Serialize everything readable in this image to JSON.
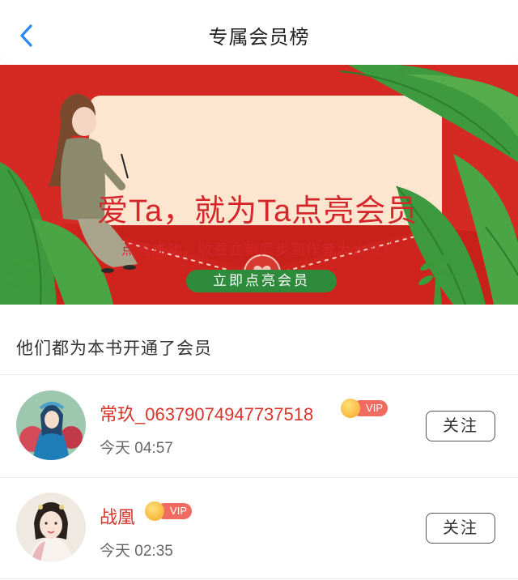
{
  "header": {
    "title": "专属会员榜",
    "back_icon": "chevron-left-icon"
  },
  "banner": {
    "title": "爱Ta，就为Ta点亮会员",
    "subtitle": "点亮成功，收益立刻同步到作者大大账户",
    "cta_label": "立即点亮会员",
    "colors": {
      "background": "#d42a23",
      "card": "#fde6cf",
      "cta": "#2e8b3c",
      "text": "#d5262c"
    }
  },
  "section": {
    "title": "他们都为本书开通了会员"
  },
  "members": [
    {
      "name": "常玖_06379074947737518",
      "badge": "VIP",
      "time": "今天 04:57",
      "follow_label": "关注"
    },
    {
      "name": "战凰",
      "badge": "VIP",
      "time": "今天 02:35",
      "follow_label": "关注"
    }
  ],
  "colors": {
    "accent_blue": "#2a8cf0",
    "name_red": "#d9342b",
    "vip_pill": "#f06b62"
  }
}
